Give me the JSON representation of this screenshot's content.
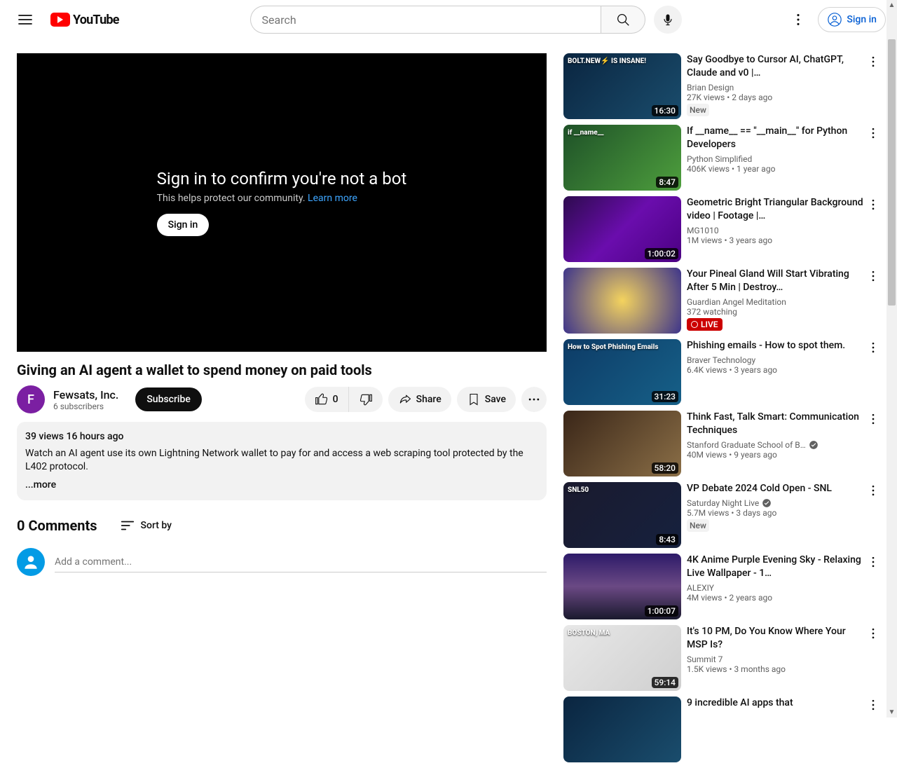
{
  "header": {
    "logo_text": "YouTube",
    "search_placeholder": "Search",
    "signin_label": "Sign in"
  },
  "player": {
    "heading": "Sign in to confirm you're not a bot",
    "sub": "This helps protect our community. ",
    "learn_more": "Learn more",
    "signin_label": "Sign in"
  },
  "video": {
    "title": "Giving an AI agent a wallet to spend money on paid tools",
    "channel_name": "Fewsats, Inc.",
    "channel_initial": "F",
    "subs": "6 subscribers",
    "subscribe_label": "Subscribe",
    "like_count": "0",
    "share_label": "Share",
    "save_label": "Save"
  },
  "description": {
    "meta": "39 views  16 hours ago",
    "text": "Watch an AI agent use its own Lightning Network wallet to pay for and access a web scraping tool protected by the L402 protocol.",
    "more": "...more"
  },
  "comments": {
    "count_label": "0 Comments",
    "sort_label": "Sort by",
    "placeholder": "Add a comment..."
  },
  "recommendations": [
    {
      "title": "Say Goodbye to Cursor AI, ChatGPT, Claude and v0 |…",
      "channel": "Brian Design",
      "meta": "27K views  • 2 days ago",
      "duration": "16:30",
      "thumb_label": "BOLT.NEW⚡ IS INSANE!",
      "thumb": "th0",
      "badge": "New",
      "verified": false
    },
    {
      "title": "If __name__ == \"__main__\" for Python Developers",
      "channel": "Python Simplified",
      "meta": "406K views  • 1 year ago",
      "duration": "8:47",
      "thumb_label": "if __name__",
      "thumb": "th1",
      "badge": null,
      "verified": false
    },
    {
      "title": "Geometric Bright Triangular Background video | Footage |…",
      "channel": "MG1010",
      "meta": "1M views  • 3 years ago",
      "duration": "1:00:02",
      "thumb_label": "",
      "thumb": "th2",
      "badge": null,
      "verified": false
    },
    {
      "title": "Your Pineal Gland Will Start Vibrating After 5 Min | Destroy…",
      "channel": "Guardian Angel Meditation",
      "meta": "372 watching",
      "duration": "",
      "thumb_label": "",
      "thumb": "th3",
      "badge": "LIVE",
      "verified": false
    },
    {
      "title": "Phishing emails - How to spot them.",
      "channel": "Braver Technology",
      "meta": "6.4K views  • 3 years ago",
      "duration": "31:23",
      "thumb_label": "How to Spot Phishing Emails",
      "thumb": "th4",
      "badge": null,
      "verified": false
    },
    {
      "title": "Think Fast, Talk Smart: Communication Techniques",
      "channel": "Stanford Graduate School of B…",
      "meta": "40M views  • 9 years ago",
      "duration": "58:20",
      "thumb_label": "",
      "thumb": "th5",
      "badge": null,
      "verified": true
    },
    {
      "title": "VP Debate 2024 Cold Open - SNL",
      "channel": "Saturday Night Live",
      "meta": "5.7M views  • 3 days ago",
      "duration": "8:43",
      "thumb_label": "SNL50",
      "thumb": "th6",
      "badge": "New",
      "verified": true
    },
    {
      "title": "4K Anime Purple Evening Sky - Relaxing Live Wallpaper - 1…",
      "channel": "ALEXIY",
      "meta": "4M views  • 2 years ago",
      "duration": "1:00:07",
      "thumb_label": "",
      "thumb": "th7",
      "badge": null,
      "verified": false
    },
    {
      "title": "It's 10 PM, Do You Know Where Your MSP Is?",
      "channel": "Summit 7",
      "meta": "1.5K views  • 3 months ago",
      "duration": "59:14",
      "thumb_label": "BOSTON, MA",
      "thumb": "th8",
      "badge": null,
      "verified": false
    },
    {
      "title": "9 incredible AI apps that",
      "channel": "",
      "meta": "",
      "duration": "",
      "thumb_label": "",
      "thumb": "th0",
      "badge": null,
      "verified": false
    }
  ]
}
